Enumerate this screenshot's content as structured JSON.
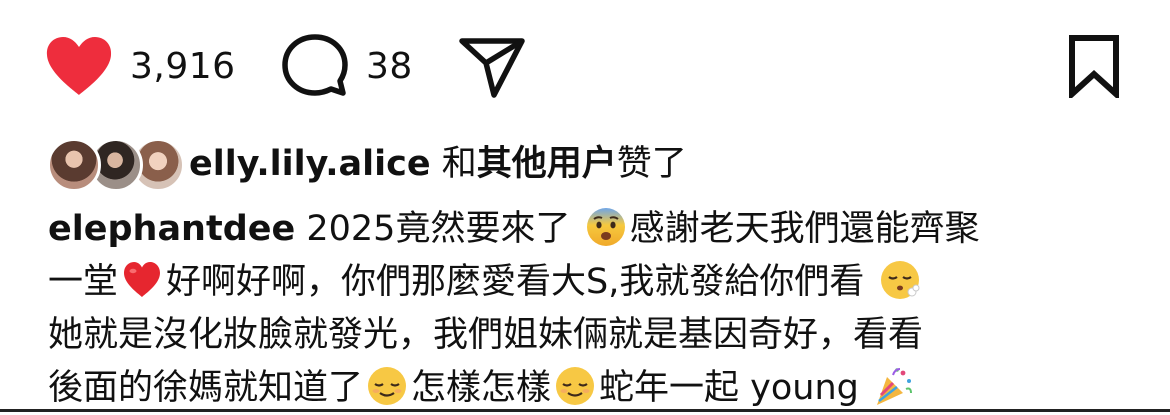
{
  "actions": {
    "like_count": "3,916",
    "comment_count": "38",
    "like_icon": "heart-filled-icon",
    "comment_icon": "comment-bubble-icon",
    "share_icon": "paper-plane-icon",
    "save_icon": "bookmark-icon",
    "like_color": "#ee2d3d"
  },
  "liked_by": {
    "username": "elly.lily.alice",
    "and_text": " 和",
    "others_text": "其他用户",
    "suffix": "赞了"
  },
  "caption": {
    "username": "elephantdee",
    "line1_a": " 2025竟然要來了",
    "line1_b": "感謝老天我們還能齊聚",
    "line2_a": "一堂",
    "line2_b": "好啊好啊，你們那麼愛看大S,我就發給你們看",
    "line3": "她就是沒化妝臉就發光，我們姐妹倆就是基因奇好，看看",
    "line4_a": "後面的徐媽就知道了",
    "line4_b": "怎樣怎樣",
    "line4_c": "蛇年一起 young",
    "emojis": [
      "anxious-face-emoji",
      "red-heart-emoji",
      "face-exhaling-emoji",
      "relieved-face-emoji",
      "relieved-face-emoji",
      "party-popper-emoji"
    ]
  }
}
